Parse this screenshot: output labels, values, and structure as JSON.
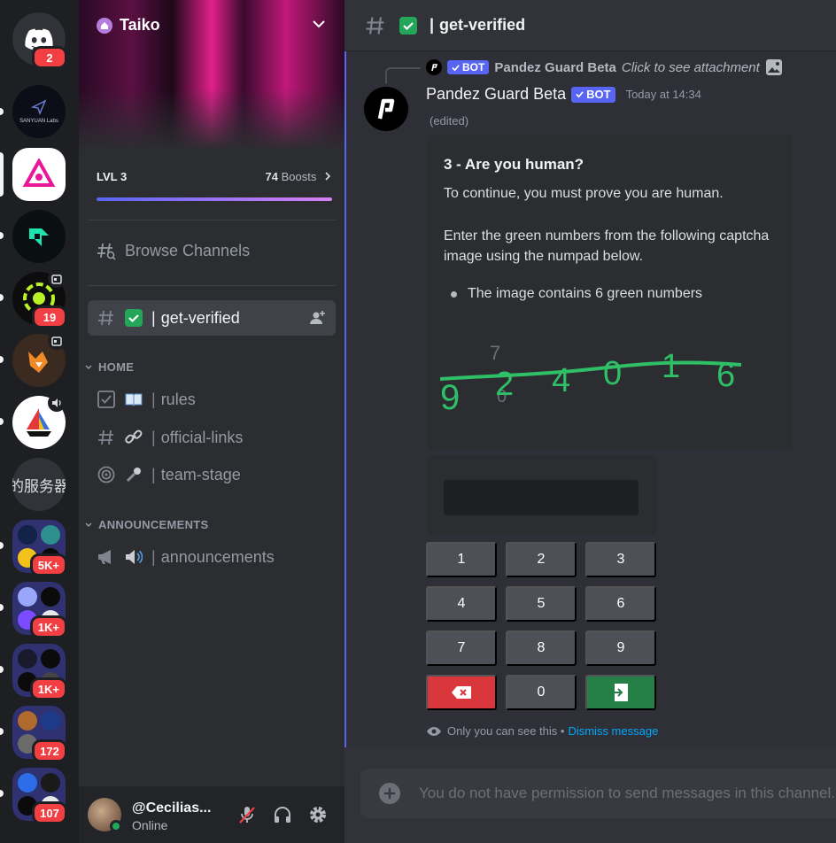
{
  "rail": {
    "dm_badge": "2",
    "sanyuan_label": "SANYUAN Labs",
    "cn_server_label": "的服务器",
    "badges": {
      "server_19": "19",
      "folder_1": "5K+",
      "folder_2": "1K+",
      "folder_3": "1K+",
      "folder_4": "172",
      "folder_5": "107"
    }
  },
  "sidebar": {
    "server_name": "Taiko",
    "boost_level": "LVL 3",
    "boost_count": "74",
    "boost_label": "Boosts",
    "browse_channels": "Browse Channels",
    "selected_channel": "get-verified",
    "categories": {
      "home": "HOME",
      "announcements": "ANNOUNCEMENTS"
    },
    "channels": {
      "rules": "rules",
      "official_links": "official-links",
      "team_stage": "team-stage",
      "announcements": "announcements"
    },
    "separator": "|"
  },
  "user": {
    "name": "@Cecilias...",
    "status": "Online"
  },
  "header": {
    "channel": "get-verified",
    "separator": "|"
  },
  "message": {
    "reply_author": "Pandez Guard Beta",
    "reply_text": "Click to see attachment",
    "bot_tag": "BOT",
    "author": "Pandez Guard Beta",
    "timestamp": "Today at 14:34",
    "edited": "(edited)",
    "embed": {
      "title": "3 - Are you human?",
      "p1": "To continue, you must prove you are human.",
      "p2": "Enter the green numbers from the following captcha image using the numpad below.",
      "bullet": "The image contains 6 green numbers"
    },
    "keypad": [
      "1",
      "2",
      "3",
      "4",
      "5",
      "6",
      "7",
      "8",
      "9",
      "0"
    ],
    "ephemeral_text": "Only you can see this •",
    "dismiss": "Dismiss message"
  },
  "composer": {
    "placeholder": "You do not have permission to send messages in this channel."
  },
  "colors": {
    "blurple": "#5865f2",
    "green": "#248046",
    "red": "#da373c",
    "link": "#00a8fc"
  }
}
